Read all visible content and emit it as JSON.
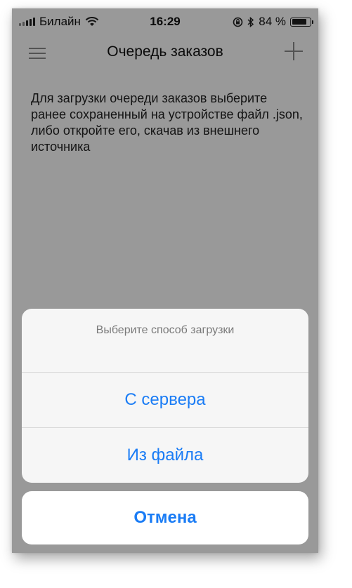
{
  "status_bar": {
    "carrier": "Билайн",
    "time": "16:29",
    "battery_percent": "84 %",
    "battery_level": 0.84,
    "signal_bars_filled": 3,
    "signal_bars_total": 5
  },
  "nav": {
    "title": "Очередь заказов",
    "menu_icon": "hamburger-icon",
    "add_icon": "plus-icon"
  },
  "content": {
    "message": "Для загрузки очереди заказов выберите ранее сохраненный на устройстве файл .json, либо откройте его, скачав из внешнего источника"
  },
  "action_sheet": {
    "title": "Выберите способ загрузки",
    "options": [
      {
        "label": "С сервера"
      },
      {
        "label": "Из файла"
      }
    ],
    "cancel_label": "Отмена"
  },
  "colors": {
    "accent": "#1a7cf5",
    "overlay": "rgba(0,0,0,0.4)"
  }
}
